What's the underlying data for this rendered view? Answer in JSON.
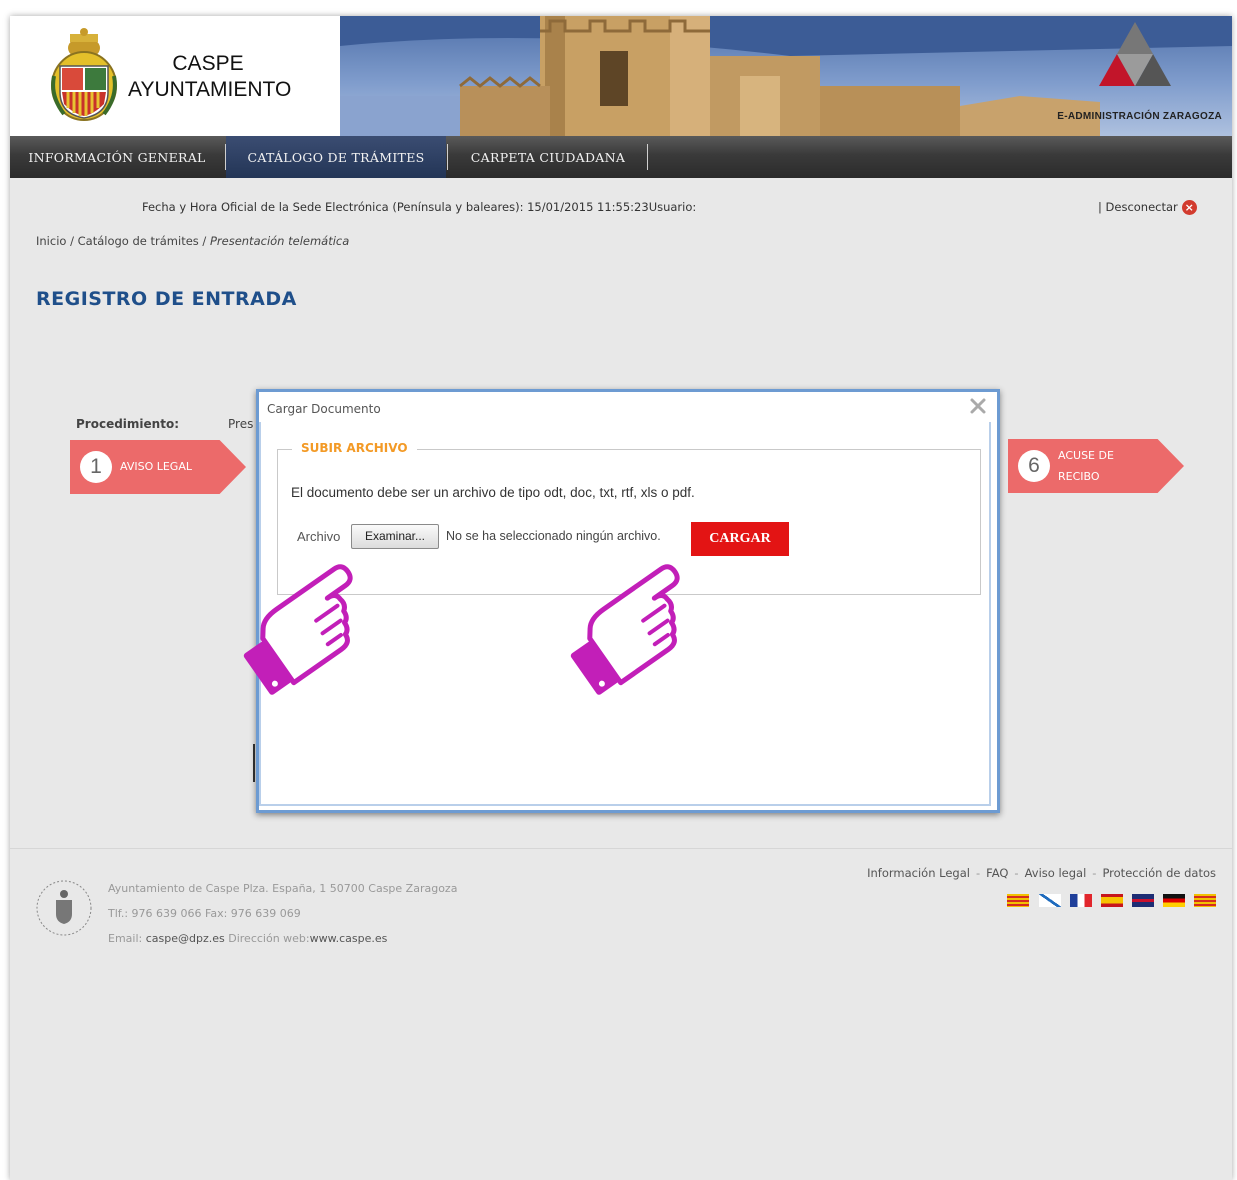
{
  "header": {
    "town_line1": "CASPE",
    "town_line2": "AYUNTAMIENTO",
    "eadmin_label": "E-ADMINISTRACIÓN ZARAGOZA"
  },
  "nav": {
    "items": [
      {
        "label": "INFORMACIÓN GENERAL",
        "active": false
      },
      {
        "label": "CATÁLOGO DE TRÁMITES",
        "active": true
      },
      {
        "label": "CARPETA CIUDADANA",
        "active": false
      }
    ]
  },
  "info": {
    "datetime_text": "Fecha y Hora Oficial de la Sede Electrónica (Península y baleares): 15/01/2015 11:55:23Usuario:",
    "disconnect_label": "| Desconectar"
  },
  "breadcrumb": {
    "home": "Inicio",
    "sep": " / ",
    "catalog": "Catálogo de trámites",
    "current": "Presentación telemática"
  },
  "page": {
    "title": "REGISTRO DE ENTRADA",
    "procedure_label": "Procedimiento:",
    "procedure_value": "Pres"
  },
  "steps": [
    {
      "num": "1",
      "label": "AVISO LEGAL"
    },
    {
      "num": "6",
      "label_line1": "ACUSE DE",
      "label_line2": "RECIBO"
    }
  ],
  "dialog": {
    "title": "Cargar Documento",
    "legend": "SUBIR ARCHIVO",
    "help_text": "El documento debe ser un archivo de tipo odt, doc, txt, rtf, xls o pdf.",
    "file_label": "Archivo",
    "browse_label": "Examinar...",
    "no_file_text": "No se ha seleccionado ningún archivo.",
    "upload_label": "CARGAR"
  },
  "footer": {
    "address": "Ayuntamiento de Caspe Plza. España, 1 50700 Caspe Zaragoza",
    "phone_fax": "Tlf.: 976 639 066 Fax: 976 639 069",
    "email_prefix": "Email: ",
    "email": "caspe@dpz.es",
    "web_prefix": " Dirección web:",
    "web": "www.caspe.es",
    "links": [
      "Información Legal",
      "FAQ",
      "Aviso legal",
      "Protección de datos"
    ],
    "link_sep": "-"
  },
  "colors": {
    "nav_active": "#2d4063",
    "title_blue": "#1f4f8a",
    "step_red": "#ec6a6a",
    "upload_red": "#e31414",
    "legend_orange": "#f39a26",
    "hand_magenta": "#c21fb8"
  },
  "icons": [
    "crest-icon",
    "castle-banner-icon",
    "eadmin-logo-icon",
    "close-x-icon",
    "disconnect-icon",
    "pointing-hand-icon",
    "seal-icon",
    "flag-icons"
  ]
}
